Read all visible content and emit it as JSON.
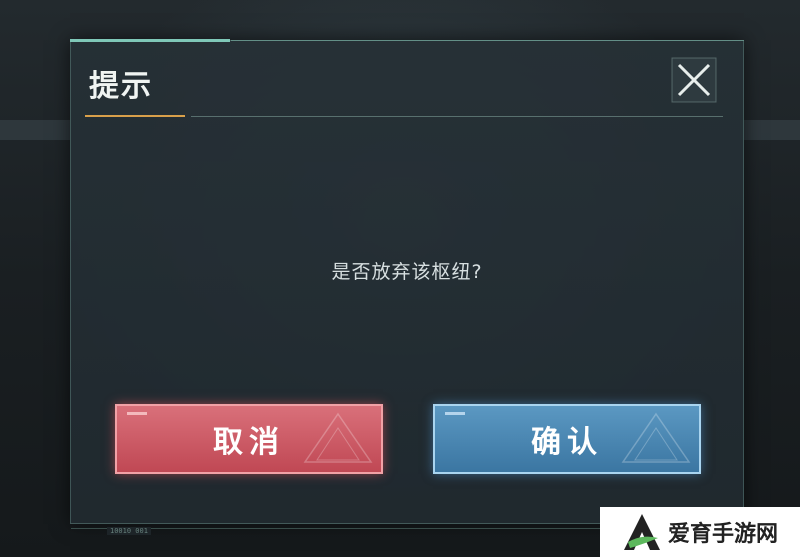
{
  "dialog": {
    "title": "提示",
    "message": "是否放弃该枢纽?",
    "footer_code": "10010 001"
  },
  "buttons": {
    "cancel_label": "取消",
    "confirm_label": "确认"
  },
  "icons": {
    "close": "close-icon",
    "watermark_logo": "a-letter-logo-icon"
  },
  "watermark": {
    "text": "爱育手游网"
  },
  "colors": {
    "cancel": "#c85560",
    "confirm": "#4a88b5",
    "accent": "#d9a04a",
    "frame": "#7fc8b8"
  }
}
